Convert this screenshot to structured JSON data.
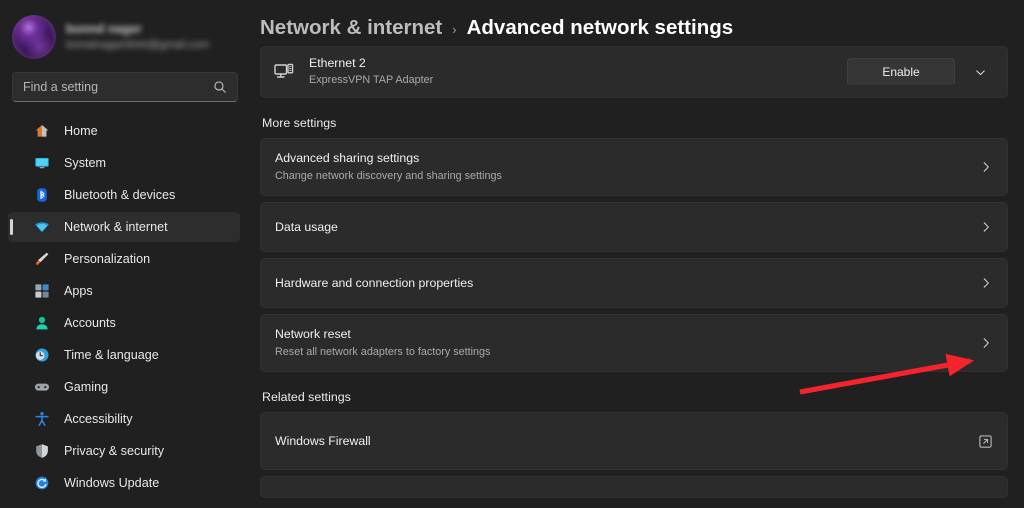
{
  "sidebar": {
    "profile": {
      "name": "bonnd nager",
      "email": "komalnagar0644@gmail.com"
    },
    "search": {
      "placeholder": "Find a setting",
      "value": "",
      "icon": "search-icon"
    },
    "items": [
      {
        "label": "Home",
        "icon": "home-icon",
        "selected": false
      },
      {
        "label": "System",
        "icon": "system-icon",
        "selected": false
      },
      {
        "label": "Bluetooth & devices",
        "icon": "bluetooth-icon",
        "selected": false
      },
      {
        "label": "Network & internet",
        "icon": "network-icon",
        "selected": true
      },
      {
        "label": "Personalization",
        "icon": "brush-icon",
        "selected": false
      },
      {
        "label": "Apps",
        "icon": "apps-icon",
        "selected": false
      },
      {
        "label": "Accounts",
        "icon": "accounts-icon",
        "selected": false
      },
      {
        "label": "Time & language",
        "icon": "clock-icon",
        "selected": false
      },
      {
        "label": "Gaming",
        "icon": "gamepad-icon",
        "selected": false
      },
      {
        "label": "Accessibility",
        "icon": "accessibility-icon",
        "selected": false
      },
      {
        "label": "Privacy & security",
        "icon": "shield-icon",
        "selected": false
      },
      {
        "label": "Windows Update",
        "icon": "update-icon",
        "selected": false
      }
    ]
  },
  "header": {
    "breadcrumb_parent": "Network & internet",
    "breadcrumb_separator": "›",
    "breadcrumb_current": "Advanced network settings"
  },
  "adapter": {
    "icon": "ethernet-adapter-icon",
    "name": "Ethernet 2",
    "description": "ExpressVPN TAP Adapter",
    "button_label": "Enable",
    "expander_icon": "chevron-down-icon"
  },
  "more_settings": {
    "heading": "More settings",
    "rows": [
      {
        "title": "Advanced sharing settings",
        "sub": "Change network discovery and sharing settings",
        "icon": "chevron-right-icon"
      },
      {
        "title": "Data usage",
        "sub": "",
        "icon": "chevron-right-icon"
      },
      {
        "title": "Hardware and connection properties",
        "sub": "",
        "icon": "chevron-right-icon"
      },
      {
        "title": "Network reset",
        "sub": "Reset all network adapters to factory settings",
        "icon": "chevron-right-icon"
      }
    ]
  },
  "related_settings": {
    "heading": "Related settings",
    "rows": [
      {
        "title": "Windows Firewall",
        "sub": "",
        "icon": "external-link-icon"
      }
    ]
  },
  "annotation": {
    "type": "arrow",
    "color": "#f5232c",
    "points_to": "Network reset"
  },
  "colors": {
    "page_background": "#202020",
    "card_background": "#2b2b2b",
    "selected_nav": "#2d2d2d",
    "text_primary": "#f0f0f0",
    "text_secondary": "#a9a9a9",
    "accent_arrow": "#f5232c"
  }
}
